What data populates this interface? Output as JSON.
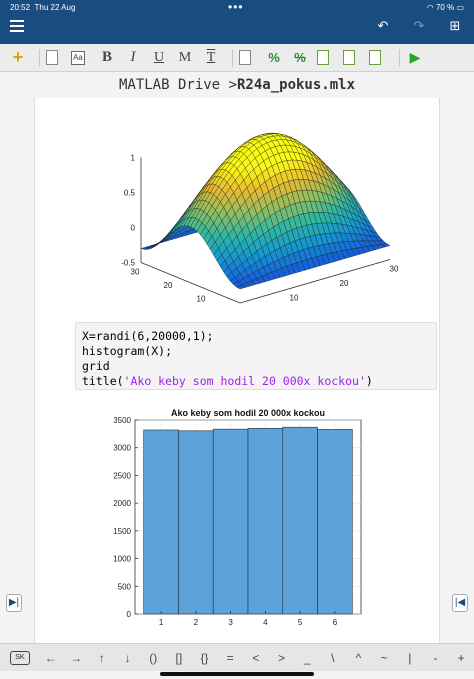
{
  "status": {
    "time": "20:52",
    "date": "Thu 22 Aug",
    "battery": "70 %"
  },
  "breadcrumb": {
    "root": "MATLAB Drive",
    "sep": ">",
    "file": "R24a_pokus.mlx"
  },
  "toolbar": {
    "text_style": "Aa",
    "bold": "B",
    "italic": "I",
    "underline": "U",
    "monospace": "M",
    "text_t": "T"
  },
  "code": {
    "line1": "X=randi(6,20000,1);",
    "line2": "histogram(X);",
    "line3": "grid",
    "line4_pre": "title(",
    "line4_str": "'Ako keby som hodil 20 000x kockou'",
    "line4_post": ")"
  },
  "keys": [
    "←",
    "→",
    "↑",
    "↓",
    "()",
    "[]",
    "{}",
    "=",
    "<",
    ">",
    "_",
    "\\",
    "^",
    "~",
    "|",
    "-",
    "+"
  ],
  "keyboard_label": "SK",
  "chart_data": [
    {
      "type": "surface",
      "zticks": [
        "-0.5",
        "0",
        "0.5",
        "1"
      ],
      "xticks": [
        "0",
        "10",
        "20",
        "30"
      ],
      "yticks": [
        "0",
        "10",
        "20",
        "30"
      ],
      "zlim": [
        -0.5,
        1
      ]
    },
    {
      "type": "bar",
      "title": "Ako keby som hodil 20 000x kockou",
      "categories": [
        "1",
        "2",
        "3",
        "4",
        "5",
        "6"
      ],
      "values": [
        3320,
        3305,
        3335,
        3350,
        3370,
        3330
      ],
      "yticks": [
        "0",
        "500",
        "1000",
        "1500",
        "2000",
        "2500",
        "3000",
        "3500"
      ],
      "ylim": [
        0,
        3500
      ],
      "grid": true,
      "bar_color": "#5ba3da"
    }
  ]
}
